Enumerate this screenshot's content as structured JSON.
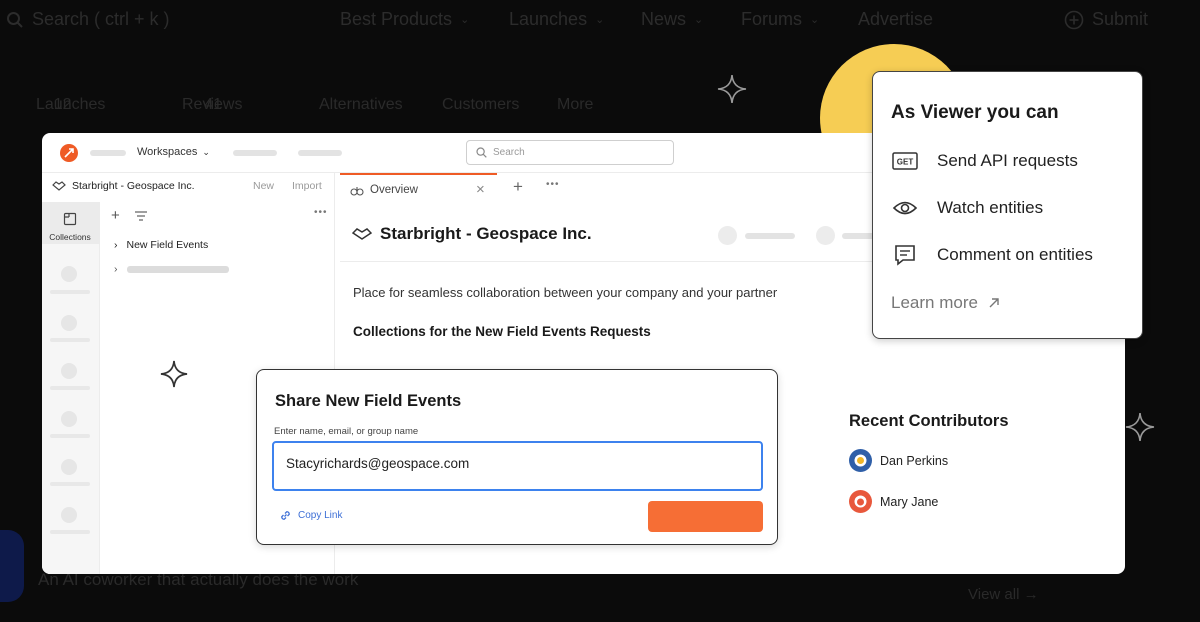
{
  "background": {
    "search_placeholder": "Search ( ctrl + k )",
    "nav_items": [
      {
        "label": "Best Products",
        "dropdown": true
      },
      {
        "label": "Launches",
        "dropdown": true
      },
      {
        "label": "News",
        "dropdown": true
      },
      {
        "label": "Forums",
        "dropdown": true
      },
      {
        "label": "Advertise",
        "dropdown": false
      }
    ],
    "submit_label": "Submit",
    "tabs": [
      {
        "label": "Launches",
        "count": "12"
      },
      {
        "label": "Reviews",
        "count": "41"
      },
      {
        "label": "Alternatives",
        "count": ""
      },
      {
        "label": "Customers",
        "count": ""
      },
      {
        "label": "More",
        "count": ""
      }
    ],
    "tagline": "An AI coworker that actually does the work",
    "view_all": "View all"
  },
  "app": {
    "topbar": {
      "workspaces_label": "Workspaces",
      "search_placeholder": "Search"
    },
    "workspace": {
      "name": "Starbright - Geospace Inc.",
      "new_label": "New",
      "import_label": "Import"
    },
    "rail": {
      "collections_label": "Collections"
    },
    "tree": {
      "items": [
        {
          "label": "New Field Events"
        }
      ]
    },
    "tab": {
      "label": "Overview"
    },
    "content": {
      "title": "Starbright - Geospace Inc.",
      "description": "Place for seamless collaboration between your company and your partner",
      "collections_title": "Collections for the New Field Events Requests",
      "recent_contributors_title": "Recent Contributors",
      "contributors": [
        {
          "name": "Dan Perkins",
          "color": "#2f5fa8"
        },
        {
          "name": "Mary Jane",
          "color": "#e8583c"
        }
      ]
    }
  },
  "share_dialog": {
    "title": "Share New Field Events",
    "input_label": "Enter name, email, or group name",
    "input_value": "Stacyrichards@geospace.com",
    "copy_link": "Copy Link",
    "button_color": "#f66e35"
  },
  "viewer_popover": {
    "title": "As Viewer you can",
    "items": [
      {
        "icon": "get-api-icon",
        "label": "Send API requests"
      },
      {
        "icon": "eye-icon",
        "label": "Watch entities"
      },
      {
        "icon": "comment-icon",
        "label": "Comment on entities"
      }
    ],
    "learn_more": "Learn more"
  },
  "colors": {
    "accent": "#ef5b25",
    "highlight_yellow": "#f6cd54",
    "input_focus": "#3d82ee"
  }
}
